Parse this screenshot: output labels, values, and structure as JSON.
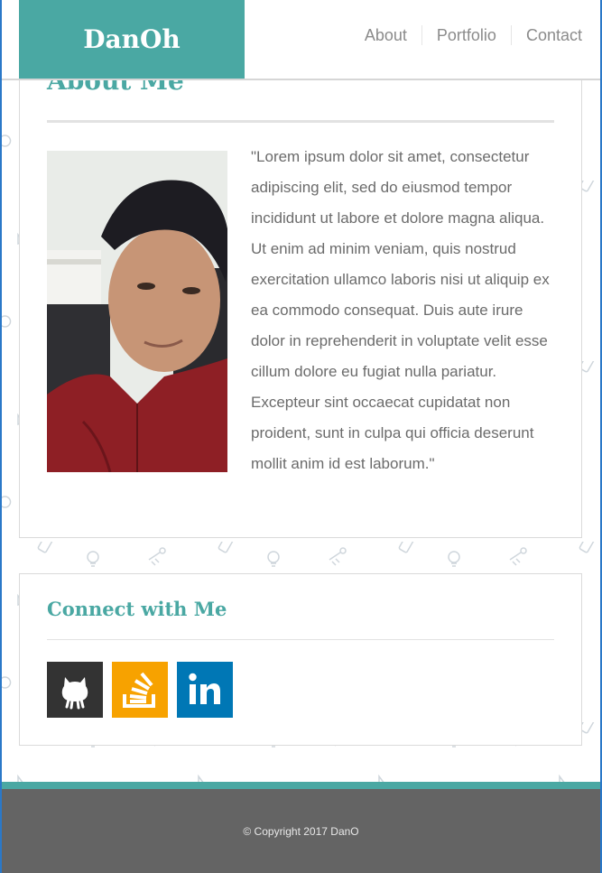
{
  "brand": "DanOh",
  "nav": [
    {
      "label": "About"
    },
    {
      "label": "Portfolio"
    },
    {
      "label": "Contact"
    }
  ],
  "about": {
    "title": "About Me",
    "bio": "\"Lorem ipsum dolor sit amet, consectetur adipiscing elit, sed do eiusmod tempor incididunt ut labore et dolore magna aliqua. Ut enim ad minim veniam, quis nostrud exercitation ullamco laboris nisi ut aliquip ex ea commodo consequat. Duis aute irure dolor in reprehenderit in voluptate velit esse cillum dolore eu fugiat nulla pariatur. Excepteur sint occaecat cupidatat non proident, sunt in culpa qui officia deserunt mollit anim id est laborum.\""
  },
  "connect": {
    "title": "Connect with Me",
    "links": [
      {
        "icon": "github-icon",
        "color": "#333333"
      },
      {
        "icon": "stackoverflow-icon",
        "color": "#f7a200"
      },
      {
        "icon": "linkedin-icon",
        "color": "#0077b5"
      }
    ]
  },
  "footer": {
    "copyright": "© Copyright 2017 DanO"
  },
  "colors": {
    "accent": "#4aa8a3",
    "footer_bg": "#646464"
  }
}
